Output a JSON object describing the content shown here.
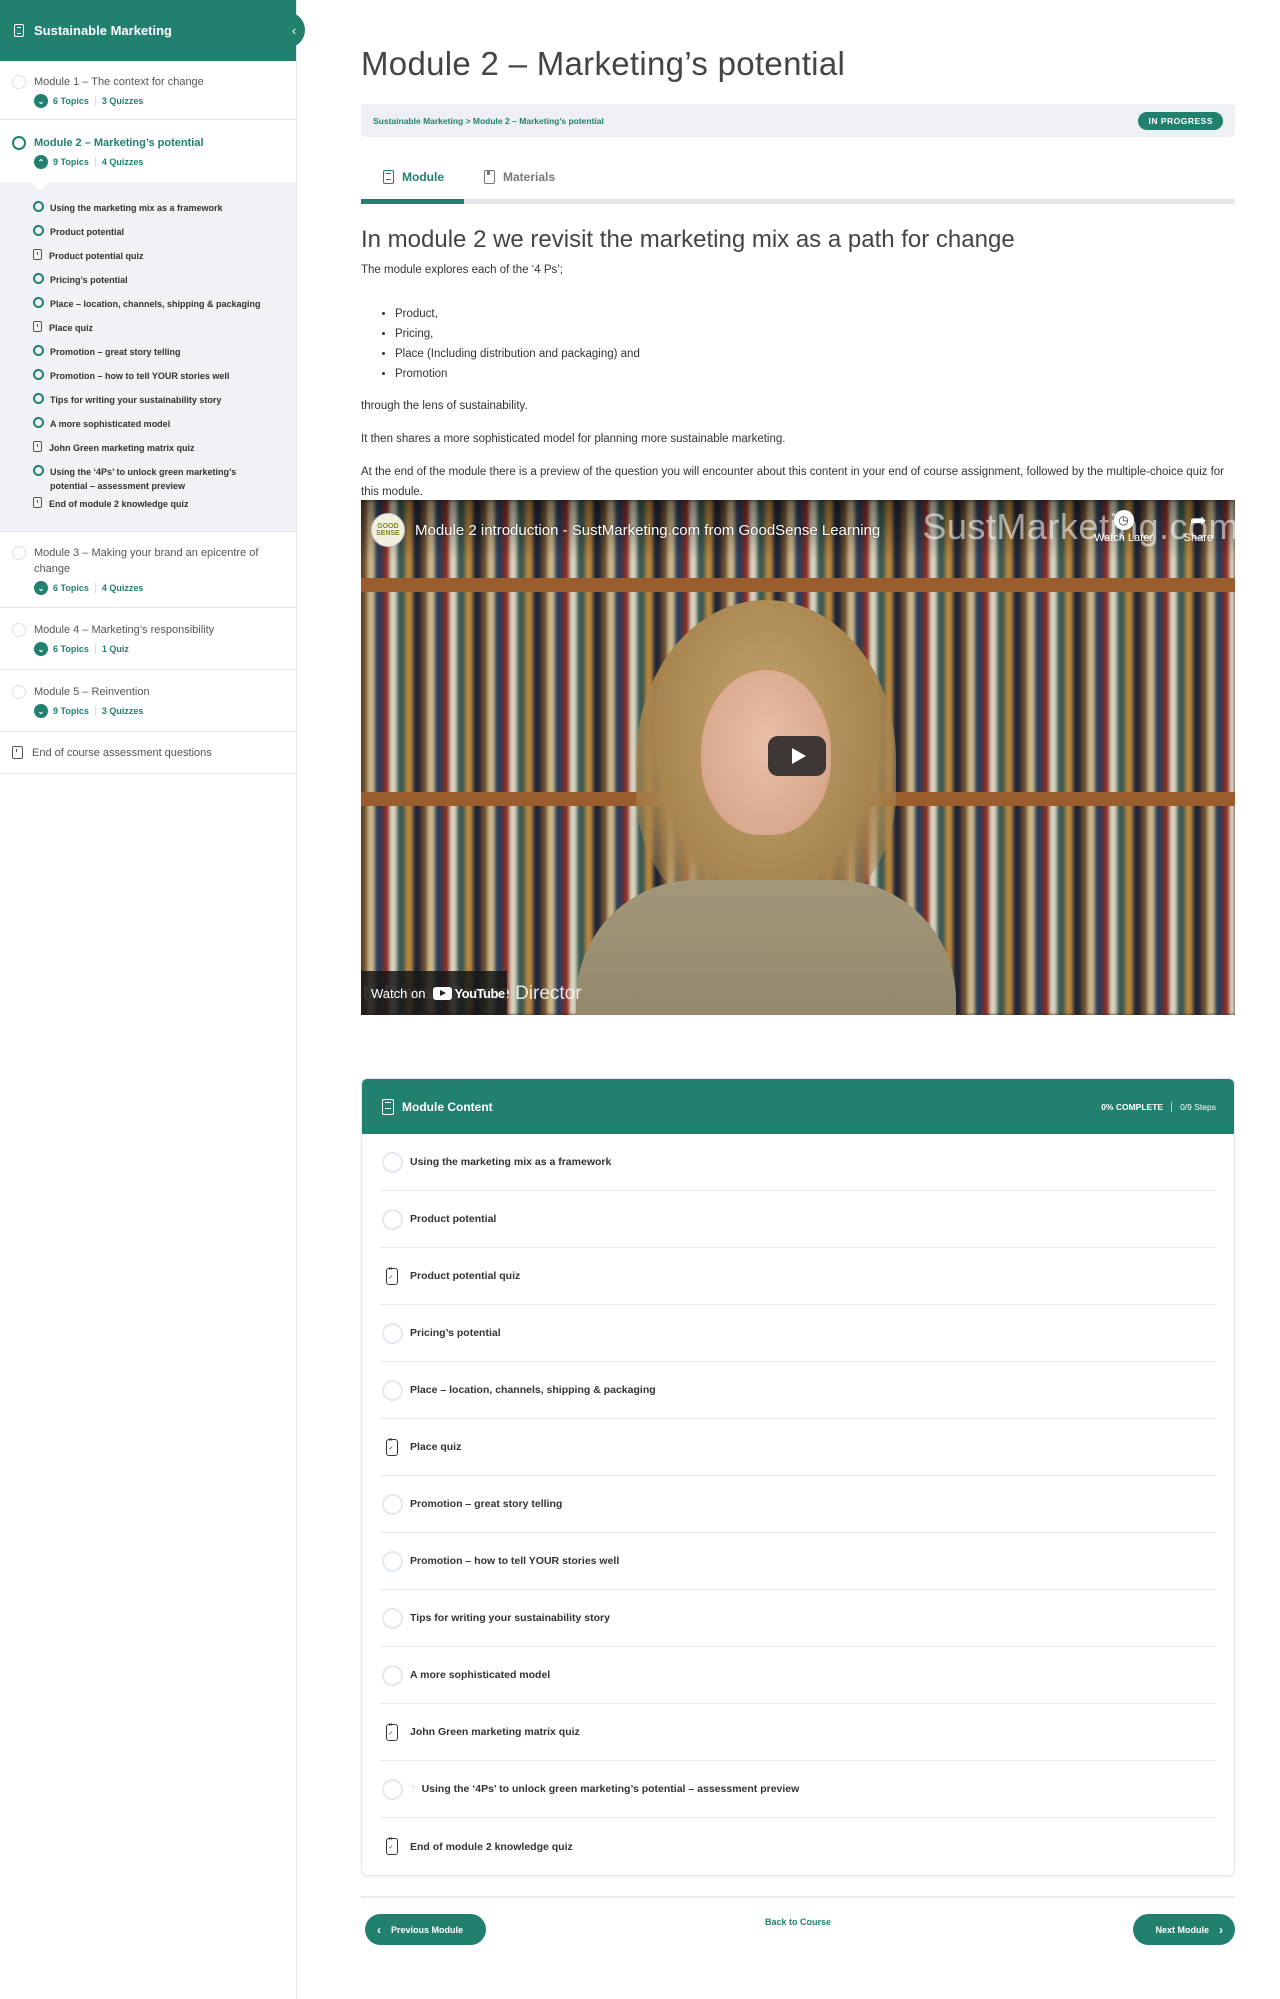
{
  "sidebar": {
    "course_title": "Sustainable Marketing",
    "modules": [
      {
        "title": "Module 1 – The context for change",
        "topics": "6 Topics",
        "quizzes": "3 Quizzes"
      },
      {
        "title": "Module 2 – Marketing’s potential",
        "topics": "9 Topics",
        "quizzes": "4 Quizzes"
      },
      {
        "title": "Module 3 – Making your brand an epicentre of change",
        "topics": "6 Topics",
        "quizzes": "4 Quizzes"
      },
      {
        "title": "Module 4 – Marketing’s responsibility",
        "topics": "6 Topics",
        "quizzes": "1 Quiz"
      },
      {
        "title": "Module 5 – Reinvention",
        "topics": "9 Topics",
        "quizzes": "3 Quizzes"
      }
    ],
    "module2_steps": [
      {
        "type": "topic",
        "label": "Using the marketing mix as a framework"
      },
      {
        "type": "topic",
        "label": "Product potential"
      },
      {
        "type": "quiz",
        "label": "Product potential quiz"
      },
      {
        "type": "topic",
        "label": "Pricing’s potential"
      },
      {
        "type": "topic",
        "label": "Place – location, channels, shipping & packaging"
      },
      {
        "type": "quiz",
        "label": "Place quiz"
      },
      {
        "type": "topic",
        "label": "Promotion – great story telling"
      },
      {
        "type": "topic",
        "label": "Promotion – how to tell YOUR stories well"
      },
      {
        "type": "topic",
        "label": "Tips for writing your sustainability story"
      },
      {
        "type": "topic",
        "label": "A more sophisticated model"
      },
      {
        "type": "quiz",
        "label": "John Green marketing matrix quiz"
      },
      {
        "type": "topic",
        "label": "Using the ‘4Ps’ to unlock green marketing’s potential – assessment preview"
      },
      {
        "type": "quiz",
        "label": "End of module 2 knowledge quiz"
      }
    ],
    "final_item": "End of course assessment questions"
  },
  "header": {
    "title": "Module 2 – Marketing’s potential",
    "breadcrumb": "Sustainable Marketing > Module 2 – Marketing’s potential",
    "status": "IN PROGRESS"
  },
  "tabs": [
    {
      "label": "Module",
      "active": true
    },
    {
      "label": "Materials",
      "active": false
    }
  ],
  "content": {
    "heading": "In module 2 we revisit the marketing mix as a path for change",
    "intro": "The module explores each of the ‘4 Ps’;",
    "bullets": [
      "Product,",
      "Pricing,",
      "Place (Including distribution and packaging) and",
      "Promotion"
    ],
    "p_lens": "through the lens of sustainability.",
    "p_model": "It then shares a more sophisticated model for planning more sustainable marketing.",
    "p_end": "At the end of the module there is a preview of the question you will encounter about this content in your end of course assignment, followed by the multiple-choice quiz for this module."
  },
  "video": {
    "channel_logo": "GOOD SENSE",
    "title": "Module 2 introduction - SustMarketing.com from GoodSense Learning",
    "watermark": "SustMarketing.com",
    "watch_later": "Watch Later",
    "share": "Share",
    "lower_third": "th Dewar, Course Director",
    "watch_on": "Watch on",
    "youtube": "YouTube"
  },
  "module_content": {
    "title": "Module Content",
    "percent_complete": "0% COMPLETE",
    "steps_progress": "0/9 Steps",
    "items": [
      {
        "type": "topic",
        "label": "Using the marketing mix as a framework"
      },
      {
        "type": "topic",
        "label": "Product potential"
      },
      {
        "type": "quiz",
        "label": "Product potential quiz"
      },
      {
        "type": "topic",
        "label": "Pricing’s potential"
      },
      {
        "type": "topic",
        "label": "Place – location, channels, shipping & packaging"
      },
      {
        "type": "quiz",
        "label": "Place quiz"
      },
      {
        "type": "topic",
        "label": "Promotion – great story telling"
      },
      {
        "type": "topic",
        "label": "Promotion – how to tell YOUR stories well"
      },
      {
        "type": "topic",
        "label": "Tips for writing your sustainability story"
      },
      {
        "type": "topic",
        "label": "A more sophisticated model"
      },
      {
        "type": "quiz",
        "label": "John Green marketing matrix quiz"
      },
      {
        "type": "topic-q",
        "label": "Using the ‘4Ps’ to unlock green marketing’s potential – assessment preview"
      },
      {
        "type": "quiz",
        "label": "End of module 2 knowledge quiz"
      }
    ]
  },
  "nav": {
    "previous": "Previous Module",
    "back": "Back to Course",
    "next": "Next Module"
  },
  "colors": {
    "accent": "#22806e"
  }
}
